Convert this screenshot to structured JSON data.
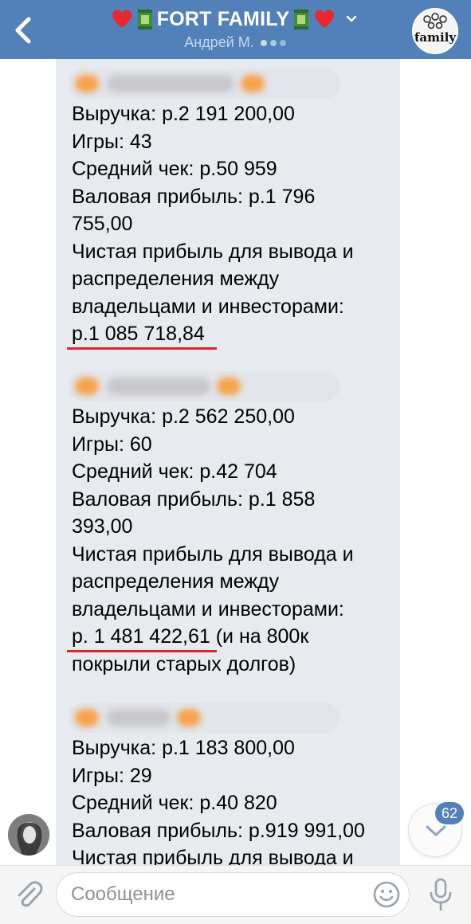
{
  "header": {
    "title": "FORT FAMILY",
    "subtitle": "Андрей М.",
    "avatar_text": "family"
  },
  "messages": [
    {
      "lines": [
        "Выручка: р.2 191 200,00",
        "Игры: 43",
        "Средний чек: р.50 959",
        "Валовая прибыль: р.1 796",
        "755,00",
        "Чистая прибыль для вывода и",
        "распределения между",
        "владельцами и инвесторами:",
        "р.1 085 718,84"
      ]
    },
    {
      "lines": [
        "Выручка: р.2 562 250,00",
        "Игры: 60",
        "Средний чек: р.42 704",
        "Валовая прибыль: р.1 858",
        "393,00",
        "Чистая прибыль для вывода и",
        "распределения между",
        "владельцами и инвесторами:",
        "р. 1 481 422,61 (и на 800к",
        "покрыли старых долгов)"
      ]
    },
    {
      "lines": [
        "Выручка: р.1 183 800,00",
        "Игры: 29",
        "Средний чек: р.40 820",
        "Валовая прибыль: р.919 991,00",
        "Чистая прибыль для вывода и"
      ]
    }
  ],
  "scroll": {
    "badge": "62"
  },
  "composer": {
    "placeholder": "Сообщение"
  },
  "colors": {
    "header": "#5181b8",
    "bubble": "#e7ebf0",
    "underline": "#e0242a"
  },
  "icons": [
    "back-arrow-icon",
    "heart-icon",
    "green-can-icon",
    "chevron-down-icon",
    "paperclip-icon",
    "smile-icon",
    "microphone-icon",
    "arrow-down-icon"
  ]
}
